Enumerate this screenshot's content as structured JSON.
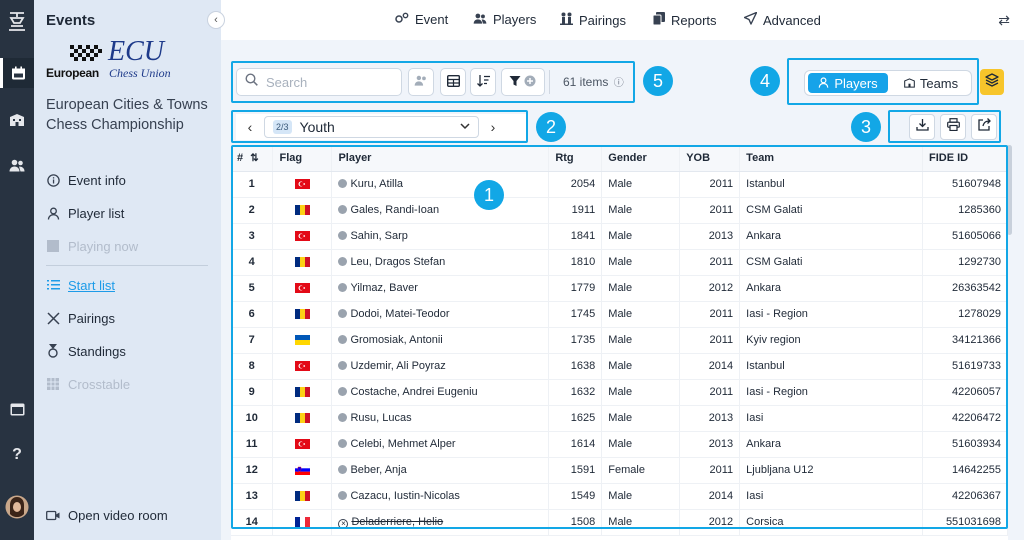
{
  "sidebar": {
    "title": "Events",
    "logo_ecu": "ECU",
    "logo_european": "European",
    "logo_union": "Chess Union",
    "tournament_name": "European Cities & Towns Chess Championship",
    "items": [
      {
        "label": "Event info",
        "icon": "info-icon",
        "state": "normal"
      },
      {
        "label": "Player list",
        "icon": "user-icon",
        "state": "normal"
      },
      {
        "label": "Playing now",
        "icon": "board-icon",
        "state": "disabled"
      },
      {
        "label": "Start list",
        "icon": "list-icon",
        "state": "active"
      },
      {
        "label": "Pairings",
        "icon": "swords-icon",
        "state": "normal"
      },
      {
        "label": "Standings",
        "icon": "medal-icon",
        "state": "normal"
      },
      {
        "label": "Crosstable",
        "icon": "grid-icon",
        "state": "disabled"
      }
    ],
    "video_room": "Open video room"
  },
  "topmenu": {
    "items": [
      {
        "label": "Event",
        "icon": "gears-icon"
      },
      {
        "label": "Players",
        "icon": "users-icon"
      },
      {
        "label": "Pairings",
        "icon": "pairings-icon"
      },
      {
        "label": "Reports",
        "icon": "copy-icon"
      },
      {
        "label": "Advanced",
        "icon": "send-icon"
      }
    ]
  },
  "toolbar": {
    "search_placeholder": "Search",
    "items_count": "61 items"
  },
  "view_toggle": {
    "players": "Players",
    "teams": "Teams",
    "selected": "Players"
  },
  "group_selector": {
    "badge": "2/3",
    "name": "Youth"
  },
  "callouts": [
    "1",
    "2",
    "3",
    "4",
    "5"
  ],
  "table": {
    "headers": [
      "#",
      "Flag",
      "Player",
      "Rtg",
      "Gender",
      "YOB",
      "Team",
      "FIDE ID"
    ],
    "rows": [
      {
        "no": "1",
        "flag": "TUR",
        "player": "Kuru, Atilla",
        "rtg": "2054",
        "gender": "Male",
        "yob": "2011",
        "team": "Istanbul",
        "fide": "51607948"
      },
      {
        "no": "2",
        "flag": "ROU",
        "player": "Gales, Randi-Ioan",
        "rtg": "1911",
        "gender": "Male",
        "yob": "2011",
        "team": "CSM Galati",
        "fide": "1285360"
      },
      {
        "no": "3",
        "flag": "TUR",
        "player": "Sahin, Sarp",
        "rtg": "1841",
        "gender": "Male",
        "yob": "2013",
        "team": "Ankara",
        "fide": "51605066"
      },
      {
        "no": "4",
        "flag": "ROU",
        "player": "Leu, Dragos Stefan",
        "rtg": "1810",
        "gender": "Male",
        "yob": "2011",
        "team": "CSM Galati",
        "fide": "1292730"
      },
      {
        "no": "5",
        "flag": "TUR",
        "player": "Yilmaz, Baver",
        "rtg": "1779",
        "gender": "Male",
        "yob": "2012",
        "team": "Ankara",
        "fide": "26363542"
      },
      {
        "no": "6",
        "flag": "ROU",
        "player": "Dodoi, Matei-Teodor",
        "rtg": "1745",
        "gender": "Male",
        "yob": "2011",
        "team": "Iasi - Region",
        "fide": "1278029"
      },
      {
        "no": "7",
        "flag": "UKR",
        "player": "Gromosiak, Antonii",
        "rtg": "1735",
        "gender": "Male",
        "yob": "2011",
        "team": "Kyiv region",
        "fide": "34121366"
      },
      {
        "no": "8",
        "flag": "TUR",
        "player": "Uzdemir, Ali Poyraz",
        "rtg": "1638",
        "gender": "Male",
        "yob": "2014",
        "team": "Istanbul",
        "fide": "51619733"
      },
      {
        "no": "9",
        "flag": "ROU",
        "player": "Costache, Andrei Eugeniu",
        "rtg": "1632",
        "gender": "Male",
        "yob": "2011",
        "team": "Iasi - Region",
        "fide": "42206057"
      },
      {
        "no": "10",
        "flag": "ROU",
        "player": "Rusu, Lucas",
        "rtg": "1625",
        "gender": "Male",
        "yob": "2013",
        "team": "Iasi",
        "fide": "42206472"
      },
      {
        "no": "11",
        "flag": "TUR",
        "player": "Celebi, Mehmet Alper",
        "rtg": "1614",
        "gender": "Male",
        "yob": "2013",
        "team": "Ankara",
        "fide": "51603934"
      },
      {
        "no": "12",
        "flag": "SLO",
        "player": "Beber, Anja",
        "rtg": "1591",
        "gender": "Female",
        "yob": "2011",
        "team": "Ljubljana U12",
        "fide": "14642255"
      },
      {
        "no": "13",
        "flag": "ROU",
        "player": "Cazacu, Iustin-Nicolas",
        "rtg": "1549",
        "gender": "Male",
        "yob": "2014",
        "team": "Iasi",
        "fide": "42206367"
      },
      {
        "no": "14",
        "flag": "FRA",
        "player": "Deladerriere, Helio",
        "rtg": "1508",
        "gender": "Male",
        "yob": "2012",
        "team": "Corsica",
        "fide": "551031698",
        "withdrawn": true
      }
    ]
  }
}
